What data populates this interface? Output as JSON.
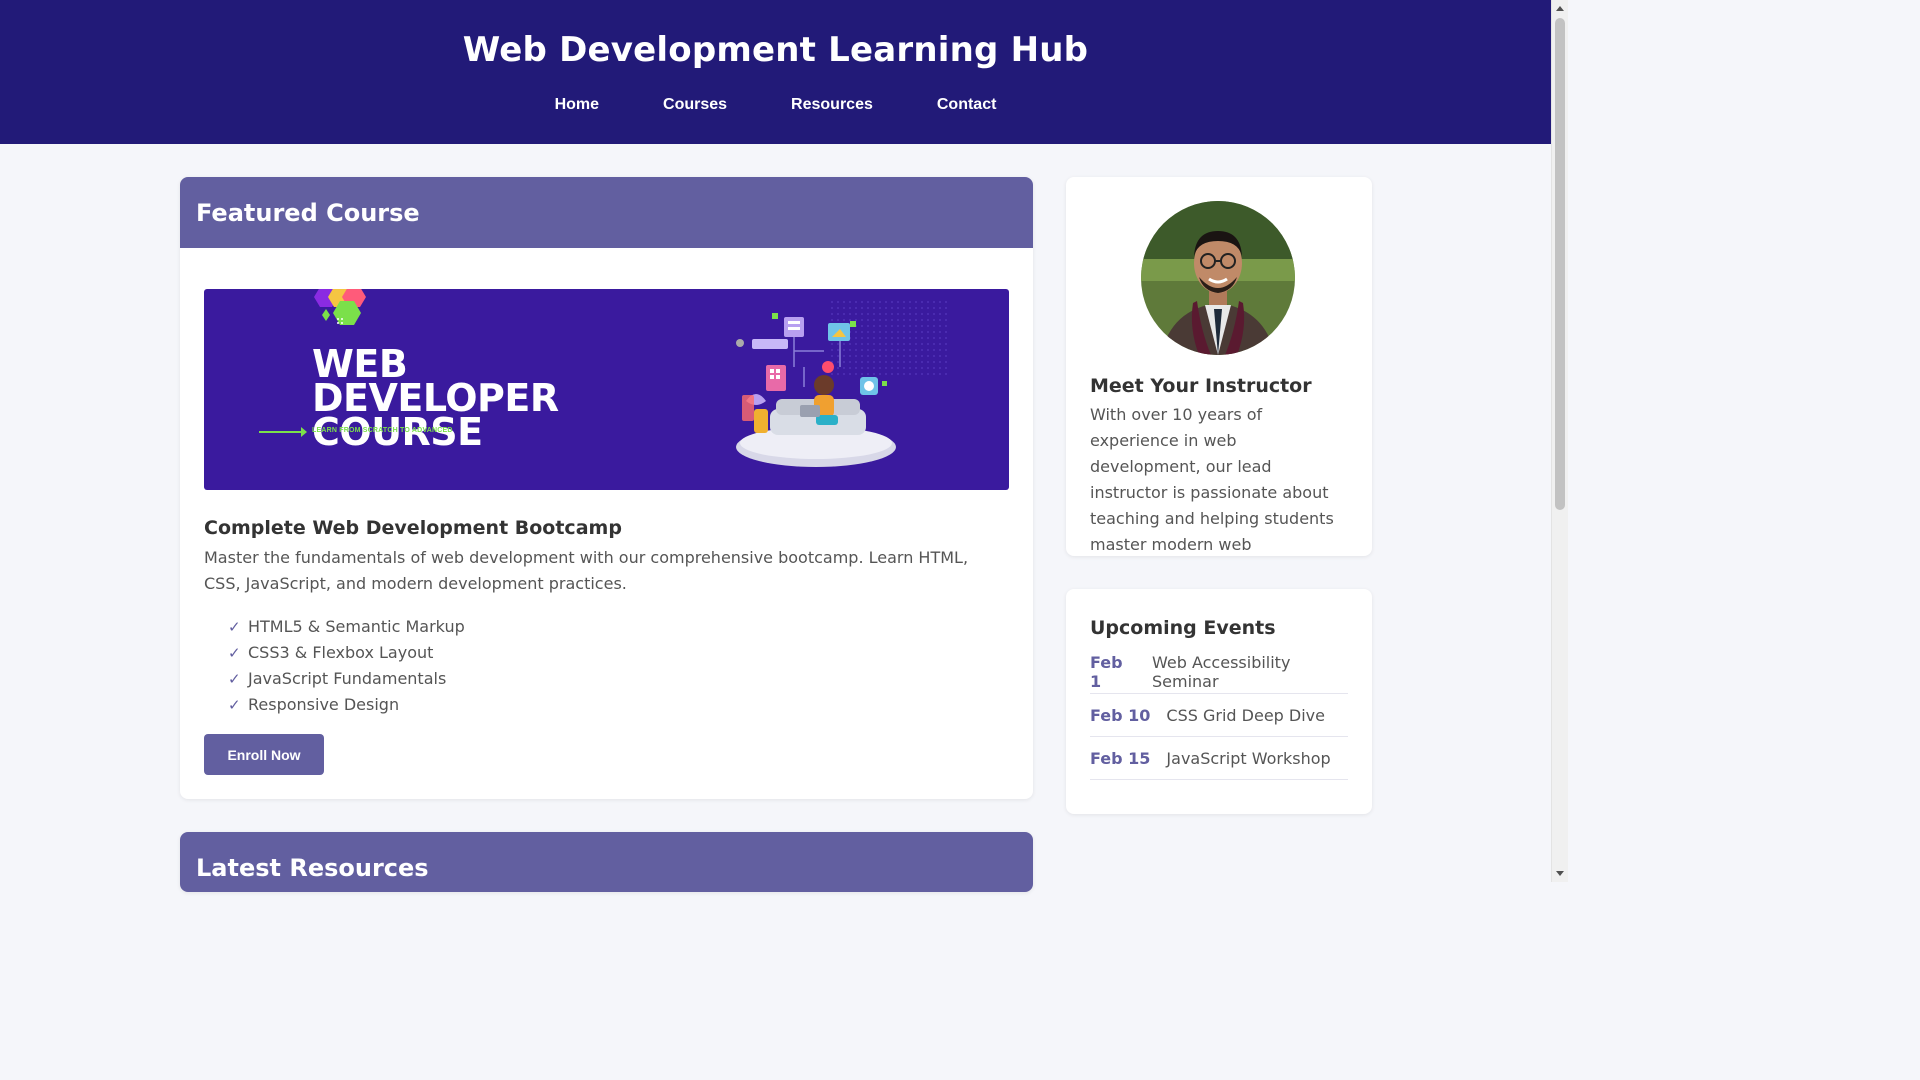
{
  "site": {
    "title": "Web Development Learning Hub"
  },
  "nav": [
    {
      "label": "Home"
    },
    {
      "label": "Courses"
    },
    {
      "label": "Resources"
    },
    {
      "label": "Contact"
    }
  ],
  "featured": {
    "heading": "Featured Course",
    "banner": {
      "title_line1": "WEB DEVELOPER",
      "title_line2": "COURSE",
      "tagline": "LEARN FROM SCRATCH TO ADVANCED"
    },
    "course_title": "Complete Web Development Bootcamp",
    "description": "Master the fundamentals of web development with our comprehensive bootcamp. Learn HTML, CSS, JavaScript, and modern development practices.",
    "features": [
      "HTML5 & Semantic Markup",
      "CSS3 & Flexbox Layout",
      "JavaScript Fundamentals",
      "Responsive Design"
    ],
    "check_glyph": "✓",
    "enroll_label": "Enroll Now"
  },
  "resources": {
    "heading": "Latest Resources"
  },
  "instructor": {
    "title": "Meet Your Instructor",
    "text": "With over 10 years of experience in web development, our lead instructor is passionate about teaching and helping students master modern web technologies."
  },
  "events": {
    "title": "Upcoming Events",
    "items": [
      {
        "date": "Feb 1",
        "name": "Web Accessibility Seminar"
      },
      {
        "date": "Feb 10",
        "name": "CSS Grid Deep Dive"
      },
      {
        "date": "Feb 15",
        "name": "JavaScript Workshop"
      }
    ]
  },
  "colors": {
    "header_bg": "#221a78",
    "accent": "#625fa0",
    "banner_bg": "#3a1a9e",
    "banner_green": "#7be04a",
    "page_bg": "#f5f6fa"
  }
}
